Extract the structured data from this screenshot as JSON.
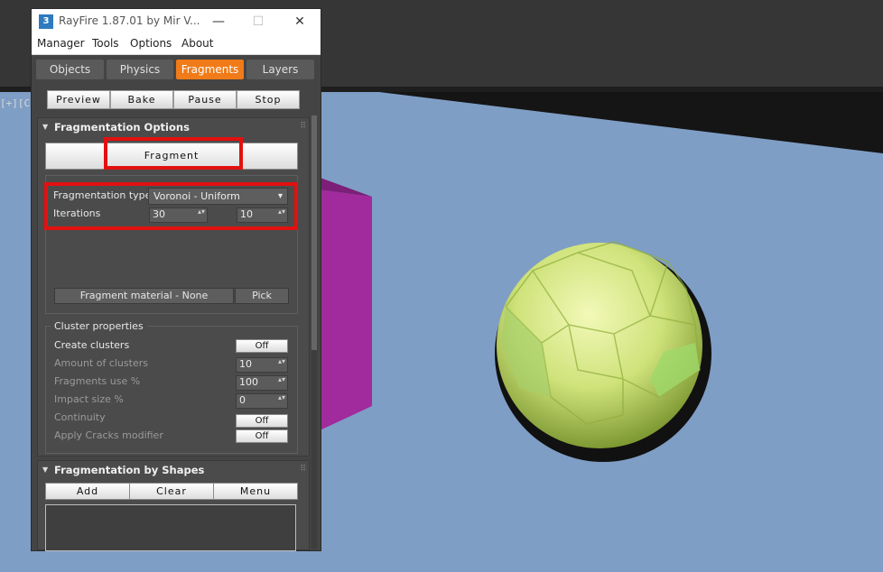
{
  "window": {
    "title": "RayFire 1.87.01   by Mir V...",
    "app_icon": "3",
    "minimize_glyph": "—",
    "maximize_glyph": "☐",
    "close_glyph": "✕"
  },
  "menu": [
    "Manager",
    "Tools",
    "Options",
    "About"
  ],
  "tabs": [
    {
      "label": "Objects",
      "active": false
    },
    {
      "label": "Physics",
      "active": false
    },
    {
      "label": "Fragments",
      "active": true
    },
    {
      "label": "Layers",
      "active": false
    }
  ],
  "toolbar": [
    "Preview",
    "Bake",
    "Pause",
    "Stop"
  ],
  "fragmentation_options": {
    "title": "Fragmentation Options",
    "fragment_button": "Fragment",
    "type_label": "Fragmentation type",
    "type_value": "Voronoi - Uniform",
    "iterations_label": "Iterations",
    "iterations_value_1": "30",
    "iterations_value_2": "10",
    "material_button": "Fragment material - None",
    "pick_button": "Pick"
  },
  "cluster": {
    "title": "Cluster properties",
    "rows": [
      {
        "label": "Create clusters",
        "type": "toggle",
        "value": "Off",
        "dim": false
      },
      {
        "label": "Amount of clusters",
        "type": "spinner",
        "value": "10",
        "dim": true
      },
      {
        "label": "Fragments use %",
        "type": "spinner",
        "value": "100",
        "dim": true
      },
      {
        "label": "Impact size %",
        "type": "spinner",
        "value": "0",
        "dim": true
      },
      {
        "label": "Continuity",
        "type": "toggle",
        "value": "Off",
        "dim": true
      },
      {
        "label": "Apply Cracks modifier",
        "type": "toggle",
        "value": "Off",
        "dim": true
      }
    ]
  },
  "shapes": {
    "title": "Fragmentation by Shapes",
    "buttons": [
      "Add",
      "Clear",
      "Menu"
    ]
  },
  "viewport": {
    "label": "[+][C"
  },
  "colors": {
    "accent": "#f07b18",
    "highlight": "#e31010",
    "viewport_bg": "#7f9ec5",
    "sphere": "#d8ea7a",
    "box": "#a0289a"
  },
  "icons": {
    "rollout_arrow": "▼",
    "grip": "⠿",
    "dropdown_arrow": "▾",
    "spinner_arrows": "▴▾"
  }
}
